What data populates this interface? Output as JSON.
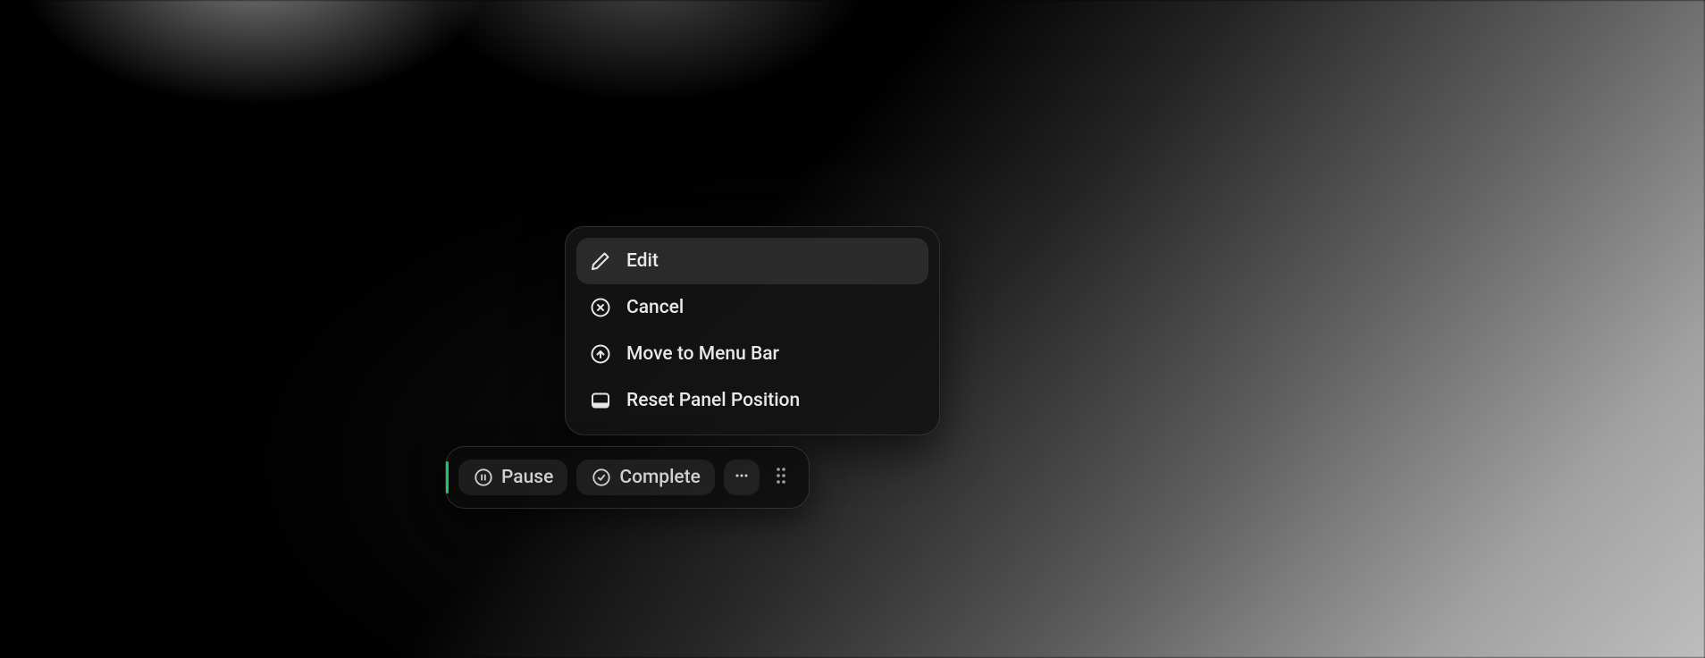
{
  "context_menu": {
    "items": [
      {
        "label": "Edit",
        "icon": "pencil-icon",
        "highlighted": true
      },
      {
        "label": "Cancel",
        "icon": "x-circle-icon",
        "highlighted": false
      },
      {
        "label": "Move to Menu Bar",
        "icon": "arrow-up-circle-icon",
        "highlighted": false
      },
      {
        "label": "Reset Panel Position",
        "icon": "panel-bottom-icon",
        "highlighted": false
      }
    ]
  },
  "panel": {
    "accent_color": "#17c964",
    "buttons": {
      "pause": {
        "label": "Pause",
        "icon": "pause-circle-icon"
      },
      "complete": {
        "label": "Complete",
        "icon": "check-circle-icon"
      },
      "more": {
        "icon": "ellipsis-icon"
      }
    }
  }
}
